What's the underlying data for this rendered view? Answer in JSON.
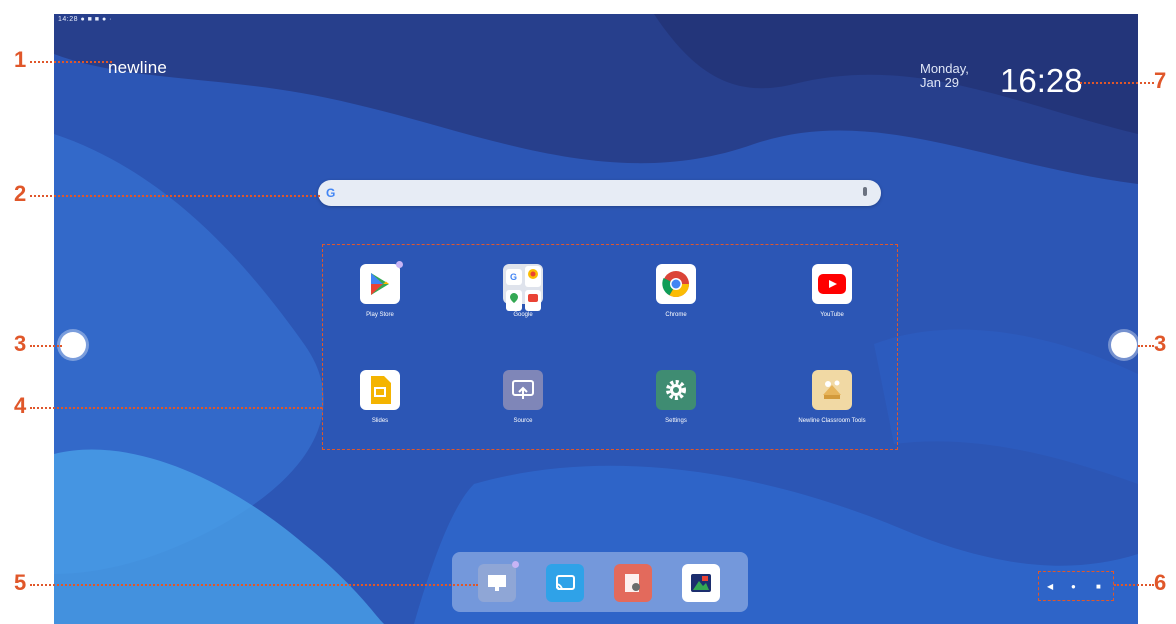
{
  "status_bar": {
    "text": "14:28 ● ■ ■ ● ·"
  },
  "logo": {
    "text": "newline"
  },
  "clock": {
    "day": "Monday,",
    "date": "Jan 29",
    "time": "16:28"
  },
  "search": {
    "google_glyph": "G"
  },
  "apps": [
    {
      "label": "Play Store",
      "icon": "play-store-icon"
    },
    {
      "label": "Google",
      "icon": "google-folder-icon"
    },
    {
      "label": "Chrome",
      "icon": "chrome-icon"
    },
    {
      "label": "YouTube",
      "icon": "youtube-icon"
    },
    {
      "label": "Slides",
      "icon": "slides-icon"
    },
    {
      "label": "Source",
      "icon": "source-icon"
    },
    {
      "label": "Settings",
      "icon": "settings-icon"
    },
    {
      "label": "Newline Classroom Tools",
      "icon": "classroom-tools-icon"
    }
  ],
  "dock": [
    {
      "icon": "whiteboard-icon"
    },
    {
      "icon": "cast-icon"
    },
    {
      "icon": "file-manager-icon"
    },
    {
      "icon": "gallery-icon"
    }
  ],
  "nav": {
    "back": "◀",
    "home": "●",
    "recents": "■"
  },
  "callouts": [
    "1",
    "2",
    "3",
    "3",
    "4",
    "5",
    "6",
    "7"
  ],
  "colors": {
    "callout": "#e0572a",
    "background": "#2a55b8"
  }
}
